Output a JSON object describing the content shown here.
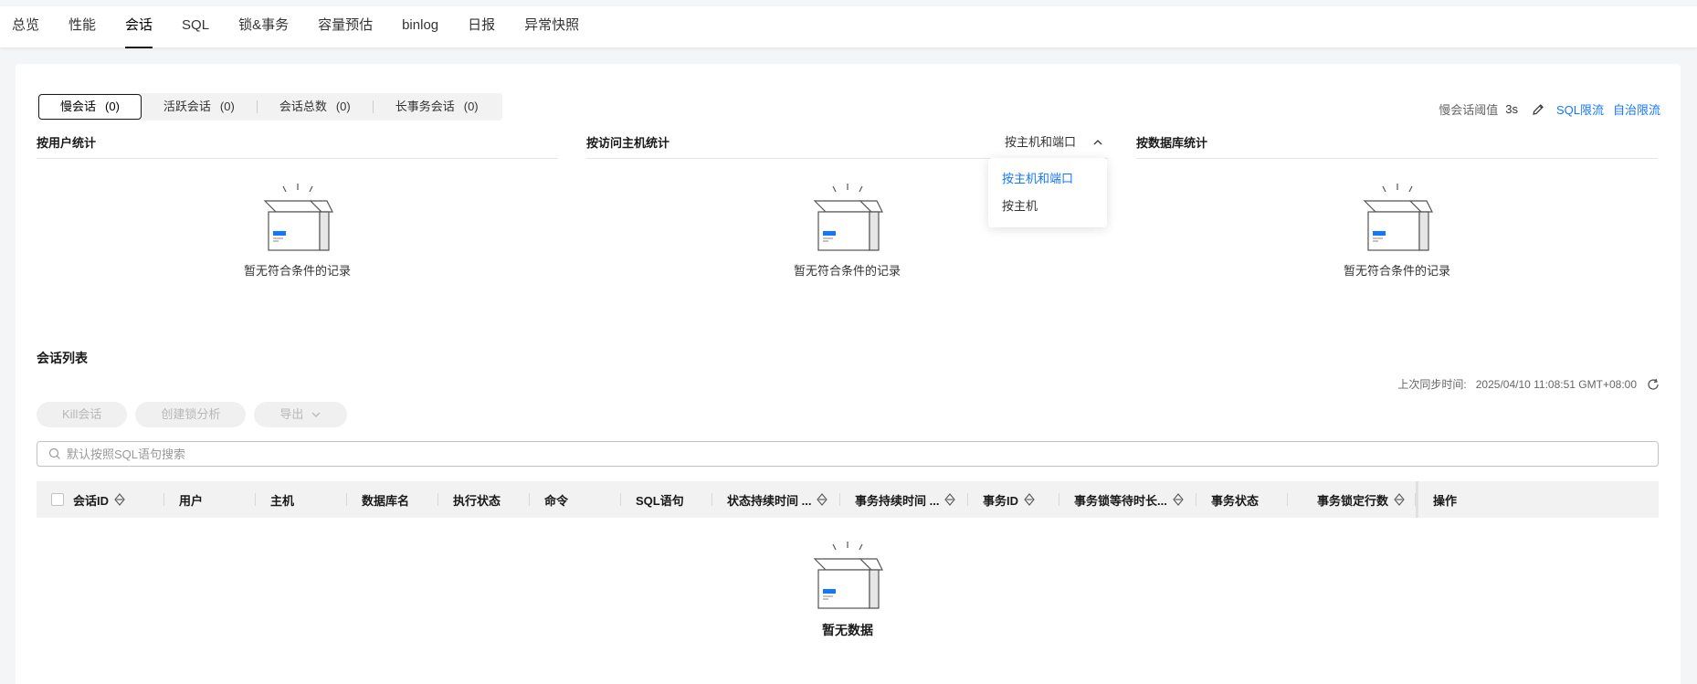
{
  "nav": {
    "tabs": [
      {
        "label": "总览"
      },
      {
        "label": "性能"
      },
      {
        "label": "会话"
      },
      {
        "label": "SQL"
      },
      {
        "label": "锁&事务"
      },
      {
        "label": "容量预估"
      },
      {
        "label": "binlog"
      },
      {
        "label": "日报"
      },
      {
        "label": "异常快照"
      }
    ],
    "active_index": 2
  },
  "segments": [
    {
      "label": "慢会话",
      "count": "(0)"
    },
    {
      "label": "活跃会话",
      "count": "(0)"
    },
    {
      "label": "会话总数",
      "count": "(0)"
    },
    {
      "label": "长事务会话",
      "count": "(0)"
    }
  ],
  "threshold": {
    "label": "慢会话阈值",
    "value": "3s",
    "sql_limit": "SQL限流",
    "auto_limit": "自治限流"
  },
  "stats": {
    "by_user": {
      "title": "按用户统计",
      "empty": "暂无符合条件的记录"
    },
    "by_host": {
      "title": "按访问主机统计",
      "selector": "按主机和端口",
      "empty": "暂无符合条件的记录"
    },
    "by_db": {
      "title": "按数据库统计",
      "empty": "暂无符合条件的记录"
    }
  },
  "dropdown": {
    "options": [
      "按主机和端口",
      "按主机"
    ],
    "selected": "按主机和端口"
  },
  "session_list": {
    "title": "会话列表",
    "sync_label": "上次同步时间:",
    "sync_value": "2025/04/10 11:08:51 GMT+08:00",
    "buttons": {
      "kill": "Kill会话",
      "lock": "创建锁分析",
      "export": "导出"
    },
    "search_placeholder": "默认按照SQL语句搜索",
    "columns": [
      "会话ID",
      "用户",
      "主机",
      "数据库名",
      "执行状态",
      "命令",
      "SQL语句",
      "状态持续时间 ...",
      "事务持续时间 ...",
      "事务ID",
      "事务锁等待时长...",
      "事务状态",
      "事务锁定行数",
      "操作"
    ],
    "empty": "暂无数据"
  },
  "colors": {
    "accent": "#1476ff",
    "text": "#191919",
    "muted": "#999999"
  }
}
